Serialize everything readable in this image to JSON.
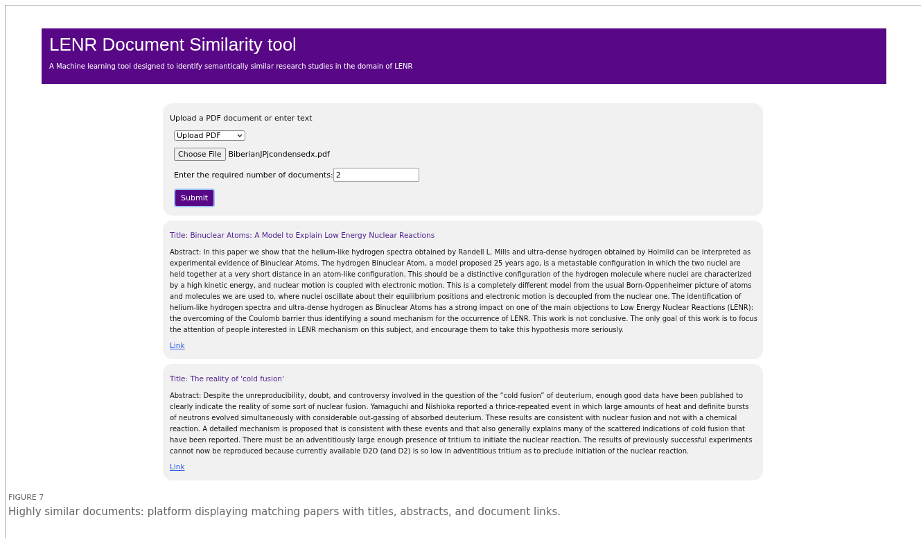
{
  "header": {
    "title": "LENR Document Similarity tool",
    "subtitle": "A Machine learning tool designed to identify semantically similar research studies in the domain of LENR"
  },
  "form": {
    "heading": "Upload a PDF document or enter text",
    "mode": "Upload PDF",
    "file_button": "Choose File",
    "file_name": "BiberianJPjcondensedx.pdf",
    "count_label": "Enter the required number of documents:",
    "count_value": "2",
    "submit": "Submit"
  },
  "results": [
    {
      "title": "Title: Binuclear Atoms: A Model to Explain Low Energy Nuclear Reactions",
      "abstract": "Abstract: In this paper we show that the helium-like hydrogen spectra obtained by Randell L. Mills and ultra-dense hydrogen obtained by Holmlid can be interpreted as experimental evidence of Binuclear Atoms. The hydrogen Binuclear Atom, a model proposed 25 years ago, is a metastable configuration in which the two nuclei are held together at a very short distance in an atom-like configuration. This should be a distinctive configuration of the hydrogen molecule where nuclei are characterized by a high kinetic energy, and nuclear motion is coupled with electronic motion. This is a completely different model from the usual Born-Oppenheimer picture of atoms and molecules we are used to, where nuclei oscillate about their equilibrium positions and electronic motion is decoupled from the nuclear one. The identification of helium-like hydrogen spectra and ultra-dense hydrogen as Binuclear Atoms has a strong impact on one of the main objections to Low Energy Nuclear Reactions (LENR): the overcoming of the Coulomb barrier thus identifying a sound mechanism for the occurrence of LENR. This work is not conclusive. The only goal of this work is to focus the attention of people interested in LENR mechanism on this subject, and encourage them to take this hypothesis more seriously.",
      "link": "Link"
    },
    {
      "title": "Title: The reality of 'cold fusion'",
      "abstract": "Abstract: Despite the unreproducibility, doubt, and controversy involved in the question of the “cold fusion” of deuterium, enough good data have been published to clearly indicate the reality of some sort of nuclear fusion. Yamaguchi and Nishioka reported a thrice-repeated event in which large amounts of heat and definite bursts of neutrons evolved simultaneously with considerable out-gassing of absorbed deuterium. These results are consistent with nuclear fusion and not with a chemical reaction. A detailed mechanism is proposed that is consistent with these events and that also generally explains many of the scattered indications of cold fusion that have been reported. There must be an adventitiously large enough presence of tritium to initiate the nuclear reaction. The results of previously successful experiments cannot now be reproduced because currently available D2O (and D2) is so low in adventitious tritium as to preclude initiation of the nuclear reaction.",
      "link": "Link"
    }
  ],
  "caption": {
    "label": "FIGURE 7",
    "text": "Highly similar documents: platform displaying matching papers with titles, abstracts, and document links."
  }
}
